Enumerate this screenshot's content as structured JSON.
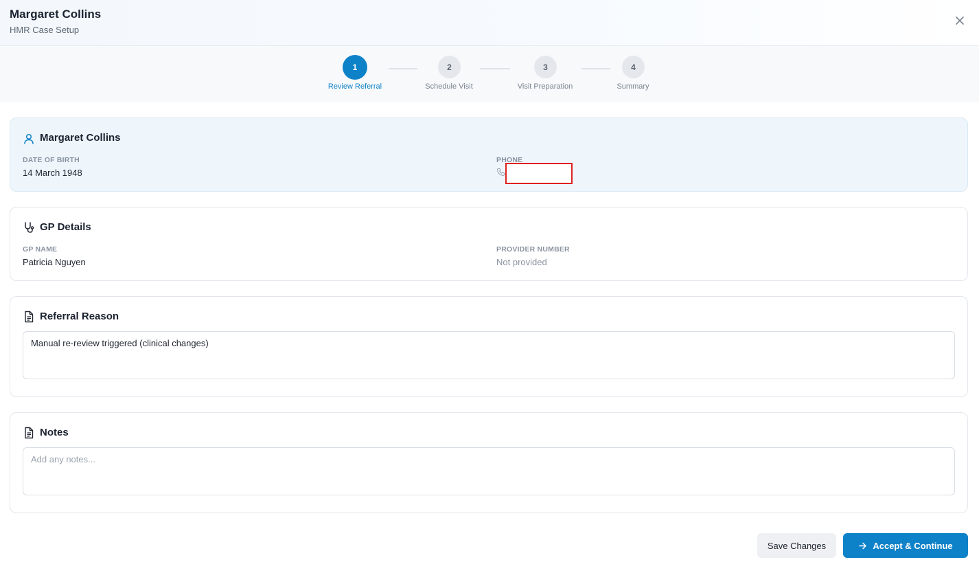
{
  "header": {
    "title": "Margaret Collins",
    "subtitle": "HMR Case Setup"
  },
  "stepper": {
    "steps": [
      {
        "number": "1",
        "label": "Review Referral",
        "state": "active"
      },
      {
        "number": "2",
        "label": "Schedule Visit",
        "state": "pending"
      },
      {
        "number": "3",
        "label": "Visit Preparation",
        "state": "pending"
      },
      {
        "number": "4",
        "label": "Summary",
        "state": "pending"
      }
    ]
  },
  "patient": {
    "name": "Margaret Collins",
    "dob_label": "DATE OF BIRTH",
    "dob_value": "14 March 1948",
    "phone_label": "PHONE",
    "phone_value": ""
  },
  "gp": {
    "title": "GP Details",
    "name_label": "GP NAME",
    "name_value": "Patricia Nguyen",
    "provider_label": "PROVIDER NUMBER",
    "provider_value": "Not provided"
  },
  "referral": {
    "title": "Referral Reason",
    "value": "Manual re-review triggered (clinical changes)"
  },
  "notes": {
    "title": "Notes",
    "placeholder": "Add any notes...",
    "value": ""
  },
  "footer": {
    "save_label": "Save Changes",
    "accept_label": "Accept & Continue"
  },
  "colors": {
    "accent": "#0e82c8",
    "step_active_label": "#0e82c8",
    "step_pending": "#e4e7eb"
  }
}
